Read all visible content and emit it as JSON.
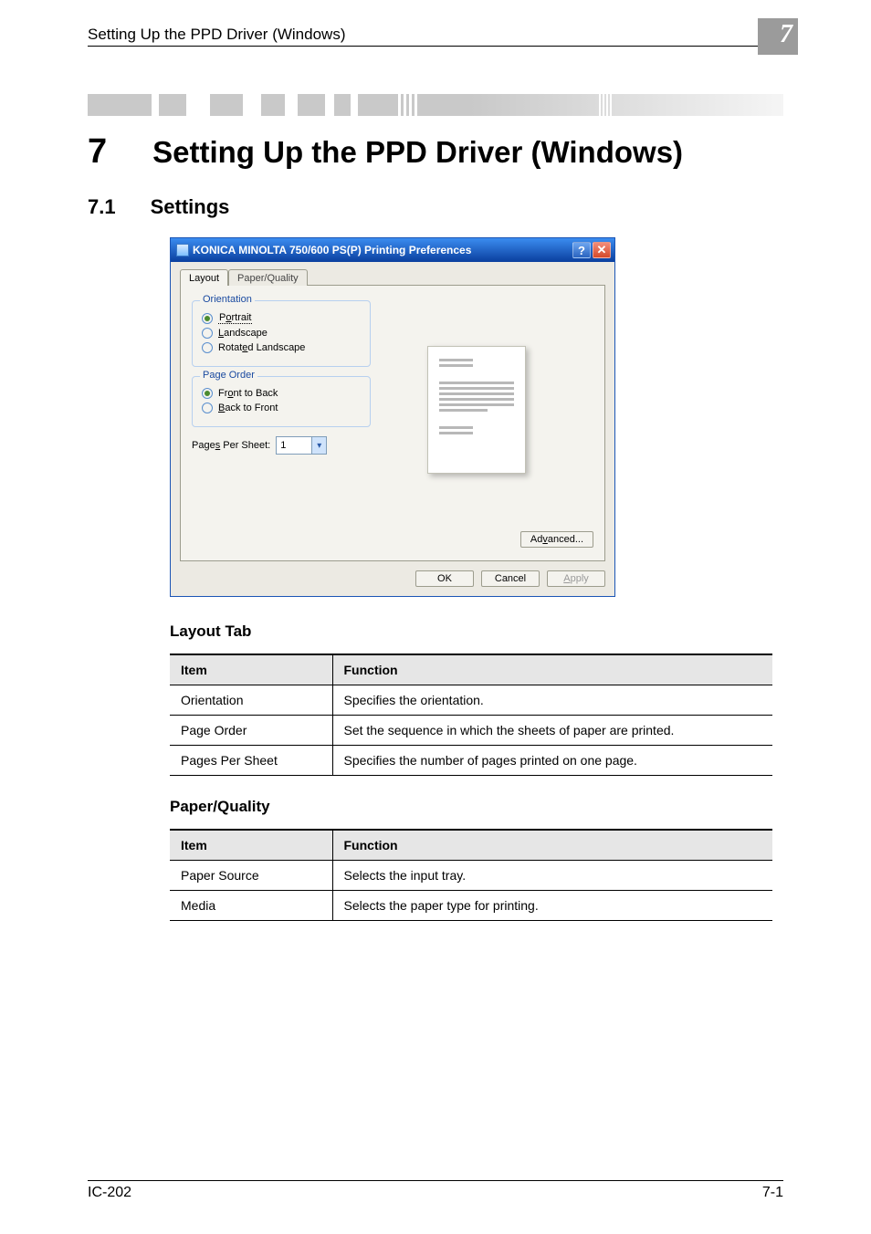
{
  "header": {
    "running_title": "Setting Up the PPD Driver (Windows)",
    "chapter_badge": "7"
  },
  "h1": {
    "num": "7",
    "text": "Setting Up the PPD Driver (Windows)"
  },
  "h2": {
    "num": "7.1",
    "text": "Settings"
  },
  "dialog": {
    "title": "KONICA MINOLTA 750/600 PS(P) Printing Preferences",
    "tabs": {
      "layout": "Layout",
      "paper_quality": "Paper/Quality"
    },
    "orientation": {
      "legend": "Orientation",
      "portrait": "Portrait",
      "landscape": "Landscape",
      "rotated": "Rotated Landscape"
    },
    "page_order": {
      "legend": "Page Order",
      "front_to_back": "Front to Back",
      "back_to_front": "Back to Front"
    },
    "pages_per_sheet": {
      "label": "Pages Per Sheet:",
      "value": "1"
    },
    "buttons": {
      "advanced": "Advanced...",
      "ok": "OK",
      "cancel": "Cancel",
      "apply": "Apply"
    }
  },
  "section_layout": {
    "heading": "Layout Tab",
    "col_item": "Item",
    "col_func": "Function",
    "rows": [
      {
        "item": "Orientation",
        "func": "Specifies the orientation."
      },
      {
        "item": "Page Order",
        "func": "Set the sequence in which the sheets of paper are printed."
      },
      {
        "item": "Pages Per Sheet",
        "func": "Specifies the number of pages printed on one page."
      }
    ]
  },
  "section_pq": {
    "heading": "Paper/Quality",
    "col_item": "Item",
    "col_func": "Function",
    "rows": [
      {
        "item": "Paper Source",
        "func": "Selects the input tray."
      },
      {
        "item": "Media",
        "func": "Selects the paper type for printing."
      }
    ]
  },
  "footer": {
    "left": "IC-202",
    "right": "7-1"
  }
}
